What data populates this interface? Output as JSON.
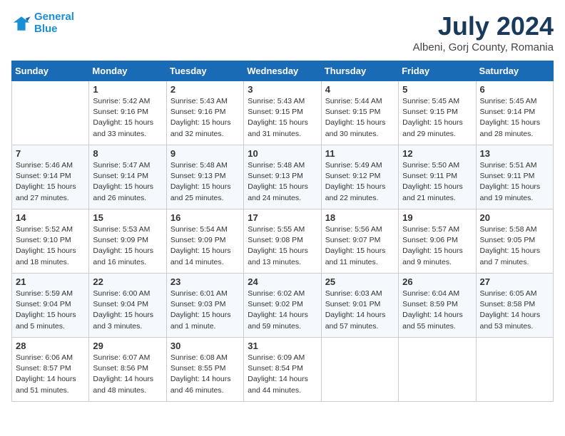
{
  "header": {
    "logo_line1": "General",
    "logo_line2": "Blue",
    "title": "July 2024",
    "subtitle": "Albeni, Gorj County, Romania"
  },
  "days_of_week": [
    "Sunday",
    "Monday",
    "Tuesday",
    "Wednesday",
    "Thursday",
    "Friday",
    "Saturday"
  ],
  "weeks": [
    [
      {
        "day": "",
        "info": ""
      },
      {
        "day": "1",
        "info": "Sunrise: 5:42 AM\nSunset: 9:16 PM\nDaylight: 15 hours\nand 33 minutes."
      },
      {
        "day": "2",
        "info": "Sunrise: 5:43 AM\nSunset: 9:16 PM\nDaylight: 15 hours\nand 32 minutes."
      },
      {
        "day": "3",
        "info": "Sunrise: 5:43 AM\nSunset: 9:15 PM\nDaylight: 15 hours\nand 31 minutes."
      },
      {
        "day": "4",
        "info": "Sunrise: 5:44 AM\nSunset: 9:15 PM\nDaylight: 15 hours\nand 30 minutes."
      },
      {
        "day": "5",
        "info": "Sunrise: 5:45 AM\nSunset: 9:15 PM\nDaylight: 15 hours\nand 29 minutes."
      },
      {
        "day": "6",
        "info": "Sunrise: 5:45 AM\nSunset: 9:14 PM\nDaylight: 15 hours\nand 28 minutes."
      }
    ],
    [
      {
        "day": "7",
        "info": "Sunrise: 5:46 AM\nSunset: 9:14 PM\nDaylight: 15 hours\nand 27 minutes."
      },
      {
        "day": "8",
        "info": "Sunrise: 5:47 AM\nSunset: 9:14 PM\nDaylight: 15 hours\nand 26 minutes."
      },
      {
        "day": "9",
        "info": "Sunrise: 5:48 AM\nSunset: 9:13 PM\nDaylight: 15 hours\nand 25 minutes."
      },
      {
        "day": "10",
        "info": "Sunrise: 5:48 AM\nSunset: 9:13 PM\nDaylight: 15 hours\nand 24 minutes."
      },
      {
        "day": "11",
        "info": "Sunrise: 5:49 AM\nSunset: 9:12 PM\nDaylight: 15 hours\nand 22 minutes."
      },
      {
        "day": "12",
        "info": "Sunrise: 5:50 AM\nSunset: 9:11 PM\nDaylight: 15 hours\nand 21 minutes."
      },
      {
        "day": "13",
        "info": "Sunrise: 5:51 AM\nSunset: 9:11 PM\nDaylight: 15 hours\nand 19 minutes."
      }
    ],
    [
      {
        "day": "14",
        "info": "Sunrise: 5:52 AM\nSunset: 9:10 PM\nDaylight: 15 hours\nand 18 minutes."
      },
      {
        "day": "15",
        "info": "Sunrise: 5:53 AM\nSunset: 9:09 PM\nDaylight: 15 hours\nand 16 minutes."
      },
      {
        "day": "16",
        "info": "Sunrise: 5:54 AM\nSunset: 9:09 PM\nDaylight: 15 hours\nand 14 minutes."
      },
      {
        "day": "17",
        "info": "Sunrise: 5:55 AM\nSunset: 9:08 PM\nDaylight: 15 hours\nand 13 minutes."
      },
      {
        "day": "18",
        "info": "Sunrise: 5:56 AM\nSunset: 9:07 PM\nDaylight: 15 hours\nand 11 minutes."
      },
      {
        "day": "19",
        "info": "Sunrise: 5:57 AM\nSunset: 9:06 PM\nDaylight: 15 hours\nand 9 minutes."
      },
      {
        "day": "20",
        "info": "Sunrise: 5:58 AM\nSunset: 9:05 PM\nDaylight: 15 hours\nand 7 minutes."
      }
    ],
    [
      {
        "day": "21",
        "info": "Sunrise: 5:59 AM\nSunset: 9:04 PM\nDaylight: 15 hours\nand 5 minutes."
      },
      {
        "day": "22",
        "info": "Sunrise: 6:00 AM\nSunset: 9:04 PM\nDaylight: 15 hours\nand 3 minutes."
      },
      {
        "day": "23",
        "info": "Sunrise: 6:01 AM\nSunset: 9:03 PM\nDaylight: 15 hours\nand 1 minute."
      },
      {
        "day": "24",
        "info": "Sunrise: 6:02 AM\nSunset: 9:02 PM\nDaylight: 14 hours\nand 59 minutes."
      },
      {
        "day": "25",
        "info": "Sunrise: 6:03 AM\nSunset: 9:01 PM\nDaylight: 14 hours\nand 57 minutes."
      },
      {
        "day": "26",
        "info": "Sunrise: 6:04 AM\nSunset: 8:59 PM\nDaylight: 14 hours\nand 55 minutes."
      },
      {
        "day": "27",
        "info": "Sunrise: 6:05 AM\nSunset: 8:58 PM\nDaylight: 14 hours\nand 53 minutes."
      }
    ],
    [
      {
        "day": "28",
        "info": "Sunrise: 6:06 AM\nSunset: 8:57 PM\nDaylight: 14 hours\nand 51 minutes."
      },
      {
        "day": "29",
        "info": "Sunrise: 6:07 AM\nSunset: 8:56 PM\nDaylight: 14 hours\nand 48 minutes."
      },
      {
        "day": "30",
        "info": "Sunrise: 6:08 AM\nSunset: 8:55 PM\nDaylight: 14 hours\nand 46 minutes."
      },
      {
        "day": "31",
        "info": "Sunrise: 6:09 AM\nSunset: 8:54 PM\nDaylight: 14 hours\nand 44 minutes."
      },
      {
        "day": "",
        "info": ""
      },
      {
        "day": "",
        "info": ""
      },
      {
        "day": "",
        "info": ""
      }
    ]
  ]
}
